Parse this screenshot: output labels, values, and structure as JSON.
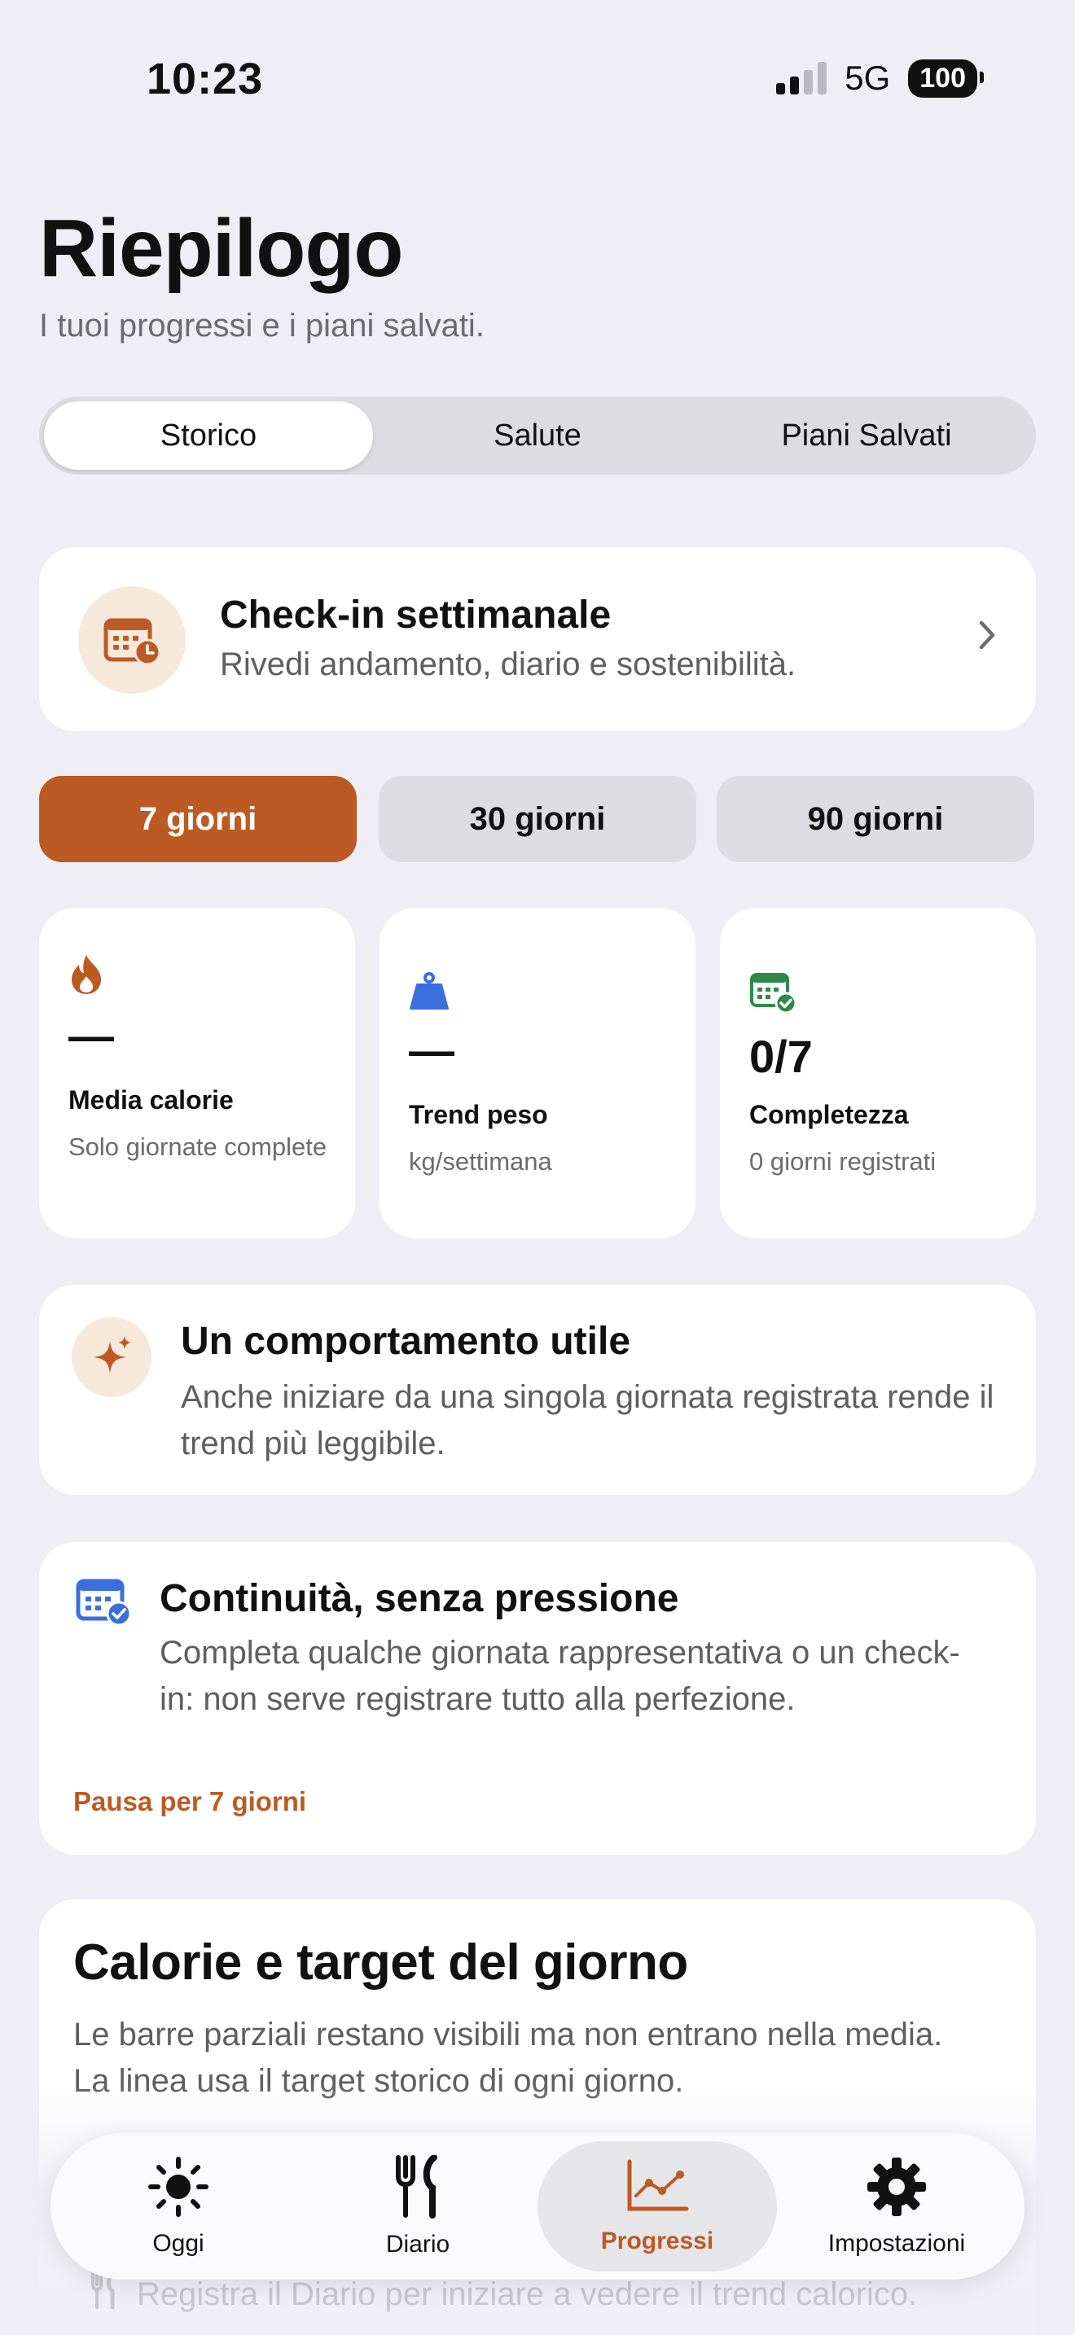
{
  "status": {
    "time": "10:23",
    "network": "5G",
    "battery": "100"
  },
  "header": {
    "title": "Riepilogo",
    "subtitle": "I tuoi progressi e i piani salvati."
  },
  "segments": [
    "Storico",
    "Salute",
    "Piani Salvati"
  ],
  "checkin": {
    "title": "Check-in settimanale",
    "description": "Rivedi andamento, diario e sostenibilità."
  },
  "ranges": [
    "7 giorni",
    "30 giorni",
    "90 giorni"
  ],
  "stats": [
    {
      "value": "—",
      "label": "Media calorie",
      "sub": "Solo giornate complete",
      "icon": "flame-icon"
    },
    {
      "value": "—",
      "label": "Trend peso",
      "sub": "kg/settimana",
      "icon": "weight-icon"
    },
    {
      "value": "0/7",
      "label": "Completezza",
      "sub": "0 giorni registrati",
      "icon": "calendar-check-icon"
    }
  ],
  "insight": {
    "title": "Un comportamento utile",
    "text": "Anche iniziare da una singola giornata registrata rende il trend più leggibile."
  },
  "continuity": {
    "title": "Continuità, senza pressione",
    "text": "Completa qualche giornata rappresentativa o un check-in: non serve registrare tutto alla perfezione.",
    "pause": "Pausa per 7 giorni"
  },
  "calories": {
    "title": "Calorie e target del giorno",
    "text": "Le barre parziali restano visibili ma non entrano nella media. La linea usa il target storico di ogni giorno."
  },
  "hint": "Registra il Diario per iniziare a vedere il trend calorico.",
  "tabs": [
    "Oggi",
    "Diario",
    "Progressi",
    "Impostazioni"
  ],
  "colors": {
    "accent": "#bc5a24",
    "background": "#efeef4",
    "blue": "#3a6fdc",
    "green": "#2f8a4a"
  }
}
